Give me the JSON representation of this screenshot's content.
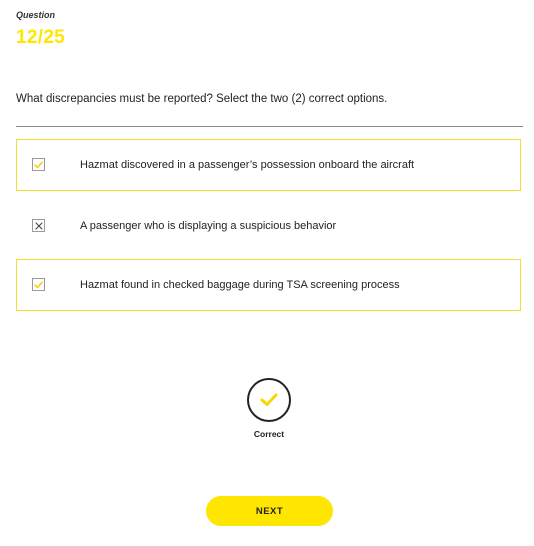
{
  "header": {
    "question_label": "Question",
    "question_count": "12/25"
  },
  "question": {
    "prompt": "What discrepancies must be reported? Select the two (2) correct options."
  },
  "options": [
    {
      "label": "Hazmat discovered in a passenger’s possession onboard the aircraft",
      "state": "selected-correct",
      "icon": "check-icon"
    },
    {
      "label": "A passenger who is displaying a suspicious behavior",
      "state": "unselected",
      "icon": "x-icon"
    },
    {
      "label": "Hazmat found in checked baggage during TSA screening process",
      "state": "selected-correct",
      "icon": "check-icon"
    }
  ],
  "result": {
    "label": "Correct",
    "icon": "check-icon"
  },
  "footer": {
    "next_label": "NEXT"
  },
  "colors": {
    "accent": "#ffe600",
    "correct_border": "#f2df31",
    "text": "#222222",
    "divider": "#888888"
  }
}
